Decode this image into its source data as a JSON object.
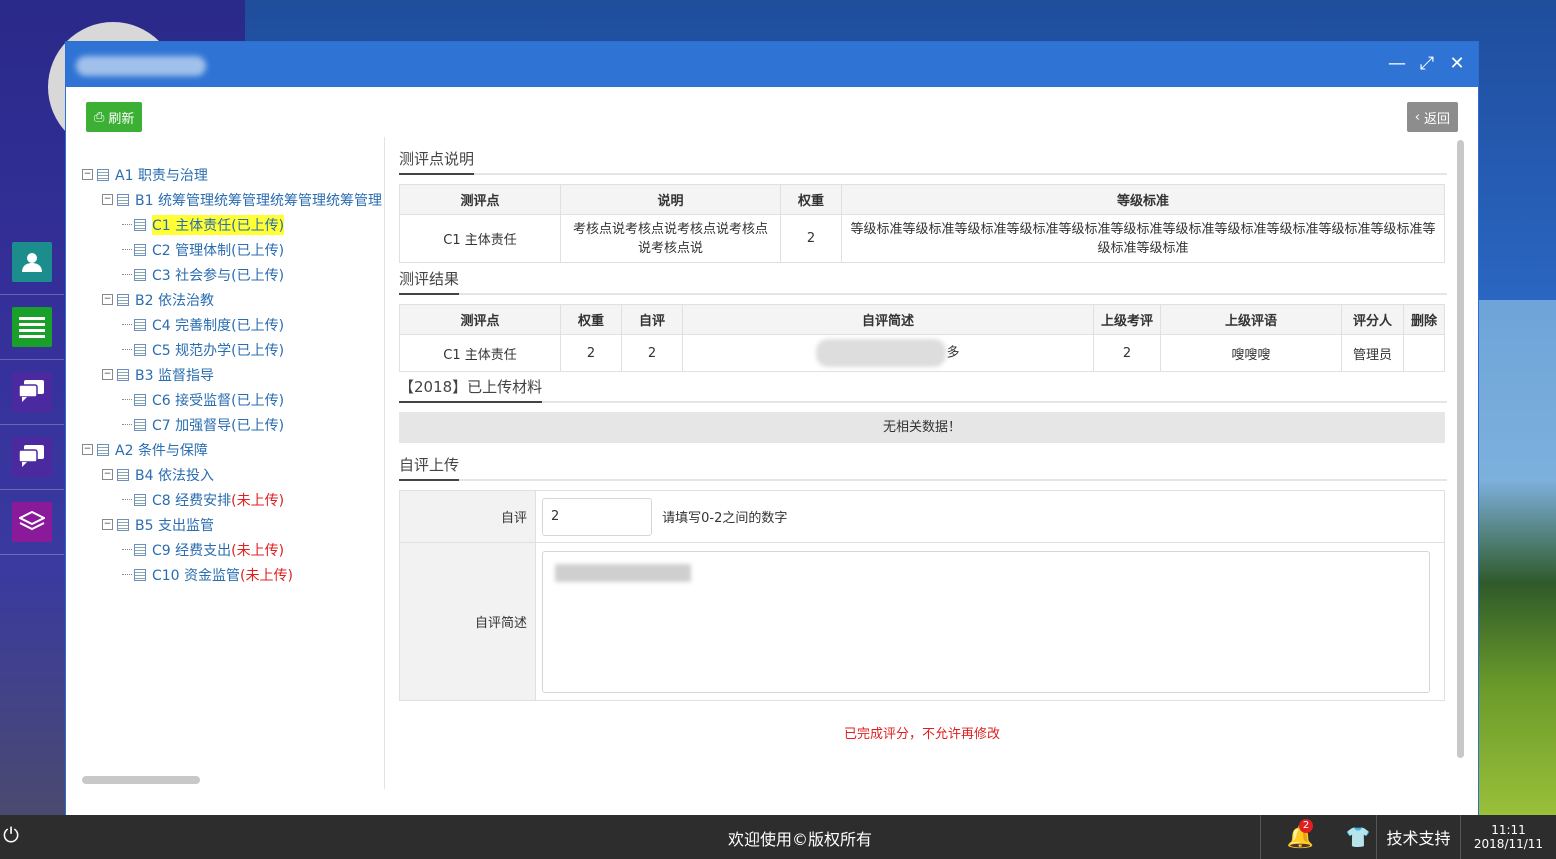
{
  "toolbar": {
    "refresh_label": "刷新",
    "back_label": "返回"
  },
  "tree": [
    {
      "level": 0,
      "code": "A1",
      "text": "职责与治理",
      "status": "",
      "state": "none"
    },
    {
      "level": 1,
      "code": "B1",
      "text": "统筹管理统筹管理统筹管理统筹管理",
      "status": "",
      "state": "none"
    },
    {
      "level": 2,
      "code": "C1",
      "text": "主体责任",
      "status": "(已上传)",
      "state": "up",
      "selected": true
    },
    {
      "level": 2,
      "code": "C2",
      "text": "管理体制",
      "status": "(已上传)",
      "state": "up"
    },
    {
      "level": 2,
      "code": "C3",
      "text": "社会参与",
      "status": "(已上传)",
      "state": "up"
    },
    {
      "level": 1,
      "code": "B2",
      "text": "依法治教",
      "status": "",
      "state": "none"
    },
    {
      "level": 2,
      "code": "C4",
      "text": "完善制度",
      "status": "(已上传)",
      "state": "up"
    },
    {
      "level": 2,
      "code": "C5",
      "text": "规范办学",
      "status": "(已上传)",
      "state": "up"
    },
    {
      "level": 1,
      "code": "B3",
      "text": "监督指导",
      "status": "",
      "state": "none"
    },
    {
      "level": 2,
      "code": "C6",
      "text": "接受监督",
      "status": "(已上传)",
      "state": "up"
    },
    {
      "level": 2,
      "code": "C7",
      "text": "加强督导",
      "status": "(已上传)",
      "state": "up"
    },
    {
      "level": 0,
      "code": "A2",
      "text": "条件与保障",
      "status": "",
      "state": "none"
    },
    {
      "level": 1,
      "code": "B4",
      "text": "依法投入",
      "status": "",
      "state": "none"
    },
    {
      "level": 2,
      "code": "C8",
      "text": "经费安排",
      "status": "(未上传)",
      "state": "no"
    },
    {
      "level": 1,
      "code": "B5",
      "text": "支出监管",
      "status": "",
      "state": "none"
    },
    {
      "level": 2,
      "code": "C9",
      "text": "经费支出",
      "status": "(未上传)",
      "state": "no"
    },
    {
      "level": 2,
      "code": "C10",
      "text": "资金监管",
      "status": "(未上传)",
      "state": "no"
    }
  ],
  "sections": {
    "desc_title": "测评点说明",
    "result_title": "测评结果",
    "material_title": "【2018】已上传材料",
    "upload_title": "自评上传"
  },
  "desc_table": {
    "headers": [
      "测评点",
      "说明",
      "权重",
      "等级标准"
    ],
    "row": {
      "point": "C1 主体责任",
      "desc": "考核点说考核点说考核点说考核点说考核点说",
      "weight": "2",
      "standard": "等级标准等级标准等级标准等级标准等级标准等级标准等级标准等级标准等级标准等级标准等级标准等级标准等级标准"
    }
  },
  "result_table": {
    "headers": [
      "测评点",
      "权重",
      "自评",
      "自评简述",
      "上级考评",
      "上级评语",
      "评分人",
      "删除"
    ],
    "row": {
      "point": "C1 主体责任",
      "weight": "2",
      "self": "2",
      "summary_tail": "多",
      "superior": "2",
      "comment": "嗖嗖嗖",
      "scorer": "管理员",
      "delete": ""
    }
  },
  "materials_empty": "无相关数据！",
  "form": {
    "self_label": "自评",
    "self_value": "2",
    "self_hint": "请填写0-2之间的数字",
    "summary_label": "自评简述"
  },
  "note": "已完成评分，不允许再修改",
  "taskbar": {
    "center_text": "欢迎使用©版权所有",
    "notif_count": "2",
    "tech_support": "技术支持",
    "time": "11:11",
    "date": "2018/11/11"
  },
  "colors": {
    "accent": "#2f74d4",
    "green": "#3cb034",
    "red": "#e02020",
    "link": "#2a6db0"
  }
}
